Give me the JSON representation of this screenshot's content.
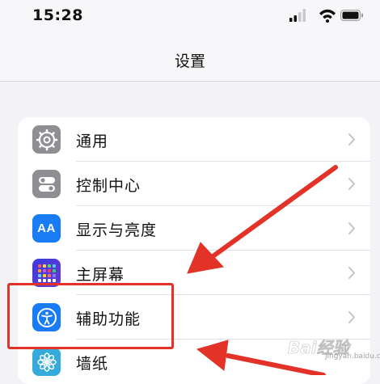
{
  "status_bar": {
    "time": "15:28",
    "icons": [
      "cellular-signal-icon",
      "wifi-icon",
      "battery-icon"
    ]
  },
  "nav": {
    "title": "设置"
  },
  "settings": {
    "items": [
      {
        "label": "通用",
        "icon": "gear-icon",
        "icon_color": "#8e8e93"
      },
      {
        "label": "控制中心",
        "icon": "toggles-icon",
        "icon_color": "#8e8e93"
      },
      {
        "label": "显示与亮度",
        "icon": "text-size-icon",
        "icon_color": "#1a7cf5",
        "icon_text": "AA"
      },
      {
        "label": "主屏幕",
        "icon": "home-screen-grid-icon",
        "icon_color": "#3a3ae0"
      },
      {
        "label": "辅助功能",
        "icon": "accessibility-icon",
        "icon_color": "#1a7cf5"
      },
      {
        "label": "墙纸",
        "icon": "flower-icon",
        "icon_color": "#35aadc"
      }
    ]
  },
  "annotation": {
    "highlight_color": "#e33228"
  },
  "watermark": {
    "brand": "Bai经验",
    "sub": "jingyan.baidu.com"
  }
}
